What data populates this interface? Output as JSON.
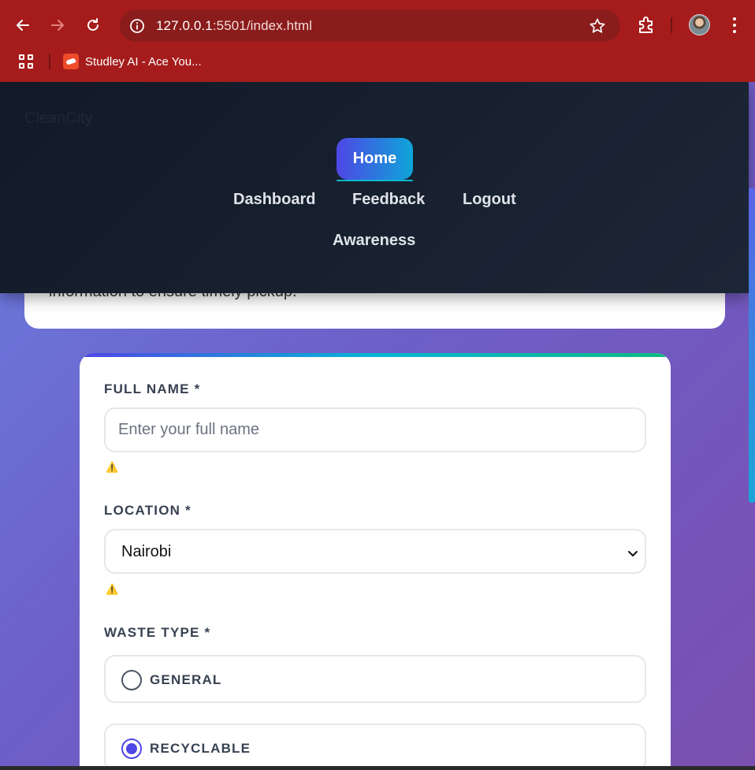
{
  "browser": {
    "url_host": "127.0.0.1",
    "url_rest": ":5501/index.html",
    "bookmark_label": "Studley AI - Ace You...",
    "chrome_color": "#a61c1c"
  },
  "header": {
    "brand": "CleanCity",
    "nav": {
      "home": "Home",
      "dashboard": "Dashboard",
      "feedback": "Feedback",
      "logout": "Logout",
      "awareness": "Awareness"
    }
  },
  "intro": {
    "text": "information to ensure timely pickup."
  },
  "form": {
    "full_name": {
      "label": "FULL NAME *",
      "placeholder": "Enter your full name",
      "warning_icon": "⚠️"
    },
    "location": {
      "label": "LOCATION *",
      "value": "Nairobi",
      "warning_icon": "⚠️"
    },
    "waste_type": {
      "label": "WASTE TYPE *",
      "options": [
        {
          "label": "GENERAL",
          "checked": false
        },
        {
          "label": "RECYCLABLE",
          "checked": true
        }
      ]
    }
  },
  "colors": {
    "accent": "#4f46e5",
    "accent2": "#0ea5d8",
    "header_bg": "#121a27"
  }
}
